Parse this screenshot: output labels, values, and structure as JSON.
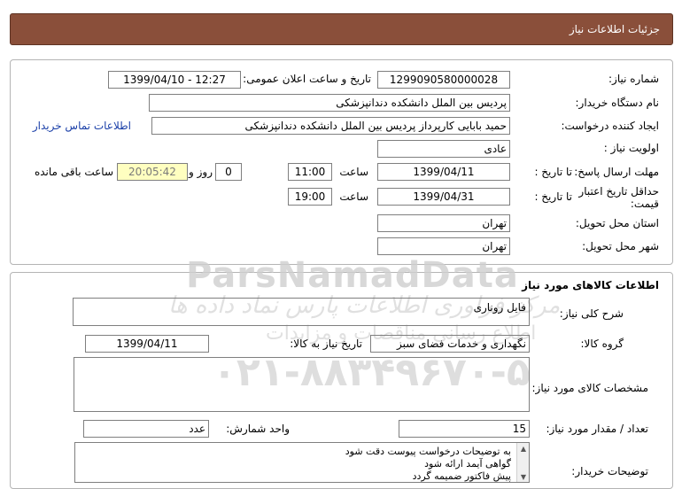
{
  "header": {
    "title": "جزئیات اطلاعات نیاز"
  },
  "need_info": {
    "need_number_label": "شماره نیاز:",
    "need_number": "1299090580000028",
    "announce_label": "تاریخ و ساعت اعلان عمومی:",
    "announce_value": "1399/04/10 - 12:27",
    "buyer_org_label": "نام دستگاه خریدار:",
    "buyer_org": "پردیس بین الملل دانشکده دندانپزشکی",
    "requester_label": "ایجاد کننده درخواست:",
    "requester": "حمید بابایی کارپرداز پردیس بین الملل دانشکده دندانپزشکی",
    "contact_link": "اطلاعات تماس خریدار",
    "priority_label": "اولویت نیاز :",
    "priority": "عادی",
    "deadline_label": "مهلت ارسال پاسخ:",
    "to_date_label": "تا تاریخ :",
    "deadline_date": "1399/04/11",
    "time_label": "ساعت",
    "deadline_time": "11:00",
    "days_value": "0",
    "days_label": "روز و",
    "remaining_time": "20:05:42",
    "remaining_label": "ساعت باقی مانده",
    "validity_label": "حداقل تاریخ اعتبار قیمت:",
    "validity_date": "1399/04/31",
    "validity_time": "19:00",
    "province_label": "استان محل تحویل:",
    "province": "تهران",
    "city_label": "شهر محل تحویل:",
    "city": "تهران"
  },
  "goods": {
    "section_title": "اطلاعات کالاهای مورد نیاز",
    "summary_label": "شرح کلی نیاز:",
    "summary": "فایل روناری",
    "group_label": "گروه کالا:",
    "group": "نگهداری و خدمات فضای سبز",
    "need_date_label": "تاریخ نیاز به کالا:",
    "need_date": "1399/04/11",
    "specs_label": "مشخصات کالای مورد نیاز:",
    "specs": "",
    "qty_label": "تعداد / مقدار مورد نیاز:",
    "qty": "15",
    "unit_label": "واحد شمارش:",
    "unit": "عدد",
    "buyer_notes_label": "توضیحات خریدار:",
    "buyer_notes": [
      "به توضیحات درخواست پیوست دقت شود",
      "گواهی آیمد ارائه شود",
      "پیش فاکتور ضمیمه گردد"
    ]
  },
  "watermark": {
    "line1": "ParsNamadData",
    "line2": "مرکز فراوری اطلاعات پارس نماد داده ها",
    "line3": "اطلاع رسانی مناقصات و مزایدات",
    "line4": "۰۲۱-۸۸۳۴۹۶۷۰-۵"
  }
}
